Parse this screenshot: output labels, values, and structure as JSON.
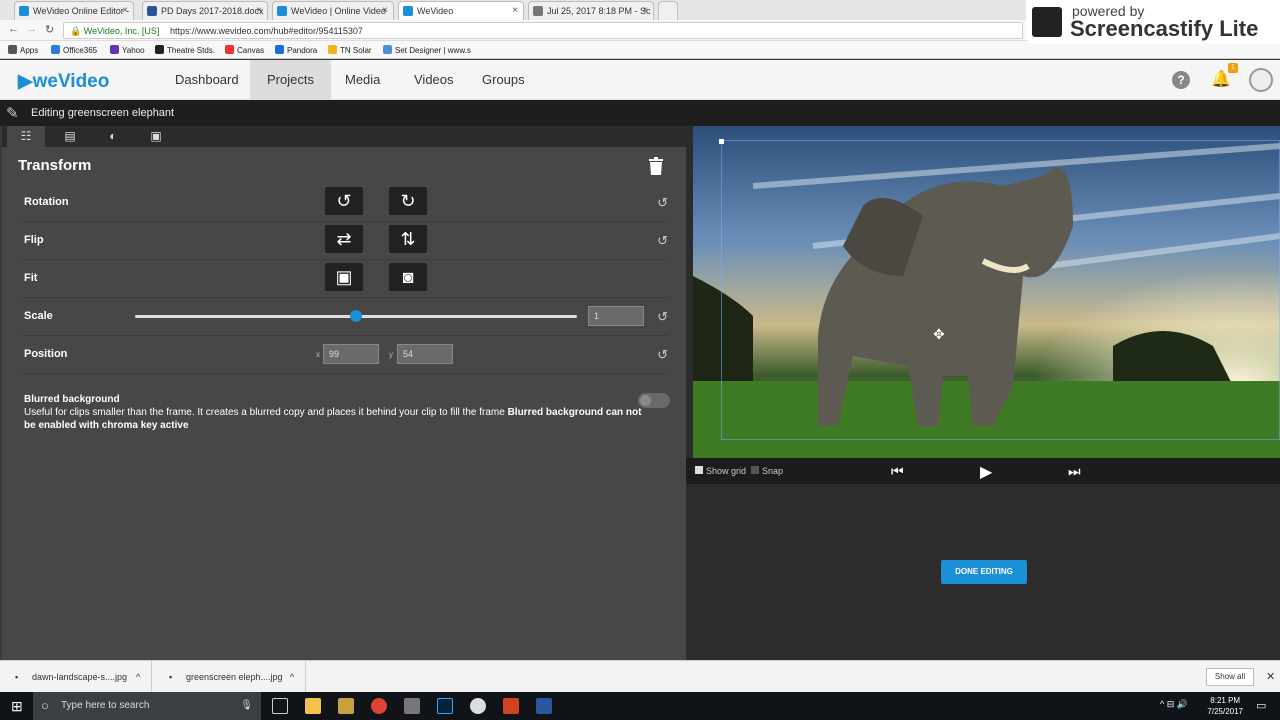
{
  "browser": {
    "tabs": [
      {
        "label": "WeVideo Online Editor -",
        "color": "#1a8fd6"
      },
      {
        "label": "PD Days 2017-2018.docx",
        "color": "#2b579a"
      },
      {
        "label": "WeVideo | Online Video",
        "color": "#1a8fd6"
      },
      {
        "label": "WeVideo",
        "color": "#1a8fd6"
      },
      {
        "label": "Jul 25, 2017 8:18 PM - Sc",
        "color": "#777777"
      }
    ],
    "secure_label": "WeVideo, Inc. [US]",
    "url": "https://www.wevideo.com/hub#editor/954115307",
    "bookmarks": [
      "Apps",
      "Office365",
      "Yahoo",
      "Theatre Stds.",
      "Canvas",
      "Pandora",
      "TN Solar",
      "Set Designer | www.s"
    ]
  },
  "overlay": {
    "line1": "powered by",
    "line2": "Screencastify Lite"
  },
  "app": {
    "logo": "weVideo",
    "nav": [
      "Dashboard",
      "Projects",
      "Media",
      "Videos",
      "Groups"
    ],
    "notification_count": "1"
  },
  "editor": {
    "title": "Editing greenscreen elephant",
    "section_title": "Transform",
    "rows": {
      "rotation": "Rotation",
      "flip": "Flip",
      "fit": "Fit",
      "scale": "Scale",
      "position": "Position"
    },
    "scale_value": "1",
    "scale_fraction": 0.5,
    "position": {
      "x_label": "x",
      "x": "99",
      "y_label": "y",
      "y": "54"
    },
    "blurred": {
      "title": "Blurred background",
      "desc": "Useful for clips smaller than the frame. It creates a blurred copy and places it behind your clip to fill the frame ",
      "warning": "Blurred background can not be enabled with chroma key active"
    },
    "show_grid": "Show grid",
    "snap": "Snap",
    "done": "DONE EDITING"
  },
  "downloads": {
    "items": [
      "dawn-landscape-s....jpg",
      "greenscreen eleph....jpg"
    ],
    "show_all": "Show all"
  },
  "taskbar": {
    "search_placeholder": "Type here to search",
    "time": "8:21 PM",
    "date": "7/25/2017"
  }
}
